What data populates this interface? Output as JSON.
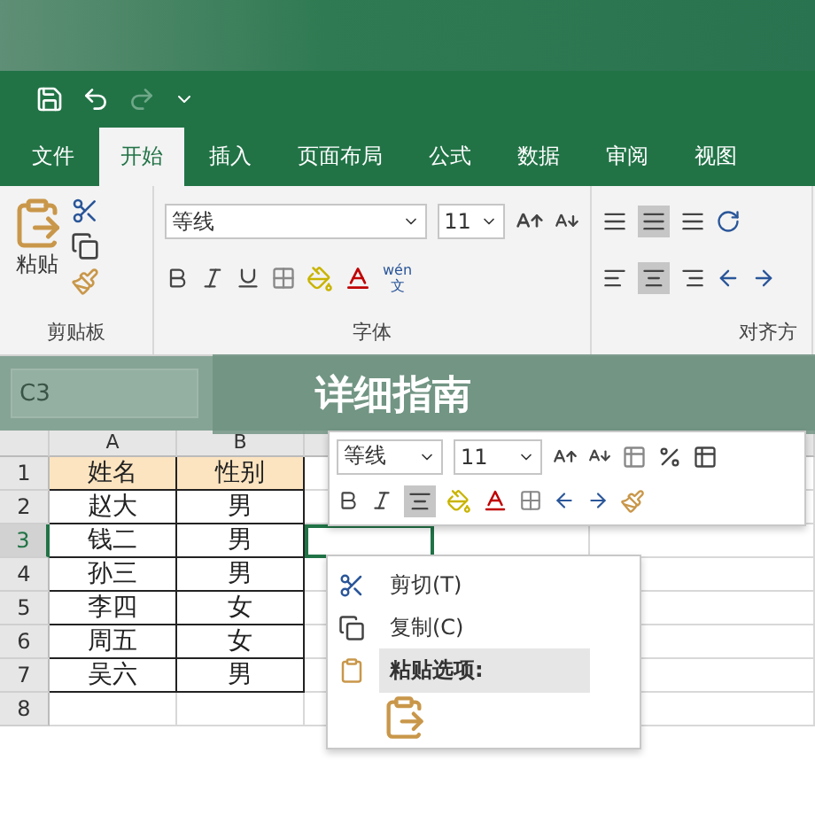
{
  "tabs": [
    {
      "label": "文件",
      "selected": false
    },
    {
      "label": "开始",
      "selected": true
    },
    {
      "label": "插入",
      "selected": false
    },
    {
      "label": "页面布局",
      "selected": false
    },
    {
      "label": "公式",
      "selected": false
    },
    {
      "label": "数据",
      "selected": false
    },
    {
      "label": "审阅",
      "selected": false
    },
    {
      "label": "视图",
      "selected": false
    }
  ],
  "ribbon": {
    "clipboard": {
      "paste_label": "粘贴",
      "group_label": "剪贴板"
    },
    "font": {
      "font_name": "等线",
      "font_size": "11",
      "phonetic": "wén",
      "phonetic_char": "文",
      "group_label": "字体"
    },
    "alignment": {
      "group_label": "对齐方"
    }
  },
  "formula_bar": {
    "name_box": "C3"
  },
  "banner": {
    "title": "详细指南"
  },
  "sheet": {
    "columns": [
      "A",
      "B"
    ],
    "rows": [
      {
        "number": "1",
        "cells": [
          "姓名",
          "性别"
        ],
        "header": true,
        "selected": false
      },
      {
        "number": "2",
        "cells": [
          "赵大",
          "男"
        ],
        "header": false,
        "selected": false
      },
      {
        "number": "3",
        "cells": [
          "钱二",
          "男"
        ],
        "header": false,
        "selected": true
      },
      {
        "number": "4",
        "cells": [
          "孙三",
          "男"
        ],
        "header": false,
        "selected": false
      },
      {
        "number": "5",
        "cells": [
          "李四",
          "女"
        ],
        "header": false,
        "selected": false
      },
      {
        "number": "6",
        "cells": [
          "周五",
          "女"
        ],
        "header": false,
        "selected": false
      },
      {
        "number": "7",
        "cells": [
          "吴六",
          "男"
        ],
        "header": false,
        "selected": false
      },
      {
        "number": "8",
        "cells": [
          "",
          ""
        ],
        "header": false,
        "selected": false
      }
    ]
  },
  "mini_toolbar": {
    "font_name": "等线",
    "font_size": "11"
  },
  "context_menu": {
    "items": [
      {
        "kind": "command",
        "label": "剪切(T)"
      },
      {
        "kind": "command",
        "label": "复制(C)"
      },
      {
        "kind": "heading",
        "label": "粘贴选项:"
      },
      {
        "kind": "paste-options"
      }
    ]
  }
}
